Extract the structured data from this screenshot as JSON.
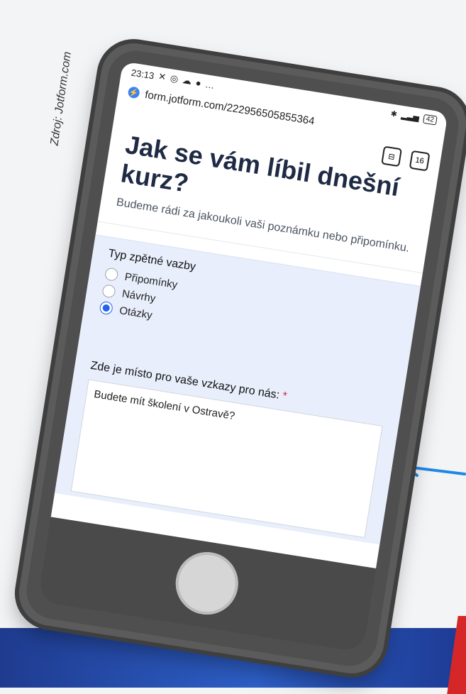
{
  "source": "Zdroj: Jotform.com",
  "status": {
    "time": "23:13",
    "battery": "42"
  },
  "browser": {
    "url": "form.jotform.com/222956505855364",
    "tab_count": "16"
  },
  "form": {
    "title": "Jak se vám líbil dnešní kurz?",
    "subtitle": "Budeme rádi za jakoukoli vaši poznámku nebo připomínku.",
    "feedback_type": {
      "label": "Typ zpětné vazby",
      "options": [
        {
          "label": "Připomínky",
          "selected": false
        },
        {
          "label": "Návrhy",
          "selected": false
        },
        {
          "label": "Otázky",
          "selected": true
        }
      ]
    },
    "message": {
      "label": "Zde je místo pro vaše vzkazy pro nás:",
      "required_marker": "*",
      "value": "Budete mít školení v Ostravě?"
    }
  },
  "colors": {
    "accent": "#2563eb",
    "band": "#2d5fc7",
    "arrow": "#1e88e5"
  }
}
